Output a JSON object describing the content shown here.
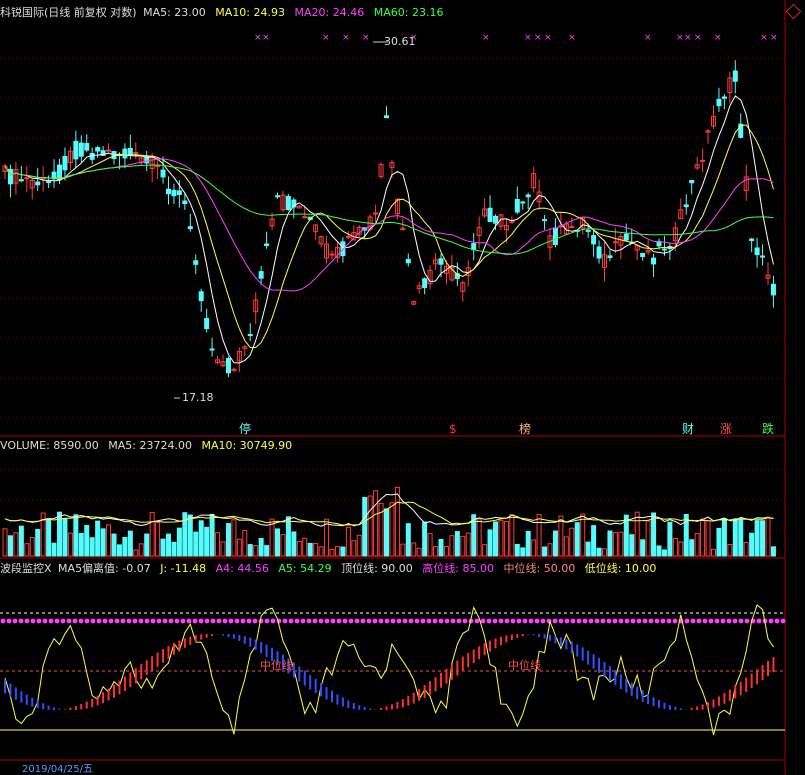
{
  "main": {
    "title": "科锐国际(日线 前复权 对数)",
    "ma5": "MA5: 23.00",
    "ma10": "MA10: 24.93",
    "ma20": "MA20: 24.46",
    "ma60": "MA60: 23.16",
    "high_label": "30.61",
    "low_label": "17.18",
    "markers": [
      "停",
      "$",
      "榜",
      "财",
      "涨",
      "跌"
    ],
    "colors": {
      "up": "#ff3c3c",
      "down": "#54fcfc",
      "ma5": "#ffffff",
      "ma10": "#ffff40",
      "ma20": "#ff40ff",
      "ma60": "#40ff40"
    }
  },
  "volume": {
    "label": "VOLUME: 8590.00",
    "ma5": "MA5: 23724.00",
    "ma10": "MA10: 30749.90"
  },
  "indicator": {
    "name": "波段监控X",
    "deviation": "MA5偏离值: -0.07",
    "j": "J: -11.48",
    "a4": "A4: 44.56",
    "a5": "A5: 54.29",
    "top": "顶位线: 90.00",
    "high": "高位线: 85.00",
    "mid": "中位线: 50.00",
    "low": "低位线: 10.00",
    "mid_tag": "中位线"
  },
  "footer": {
    "date": "2019/04/25/五"
  }
}
